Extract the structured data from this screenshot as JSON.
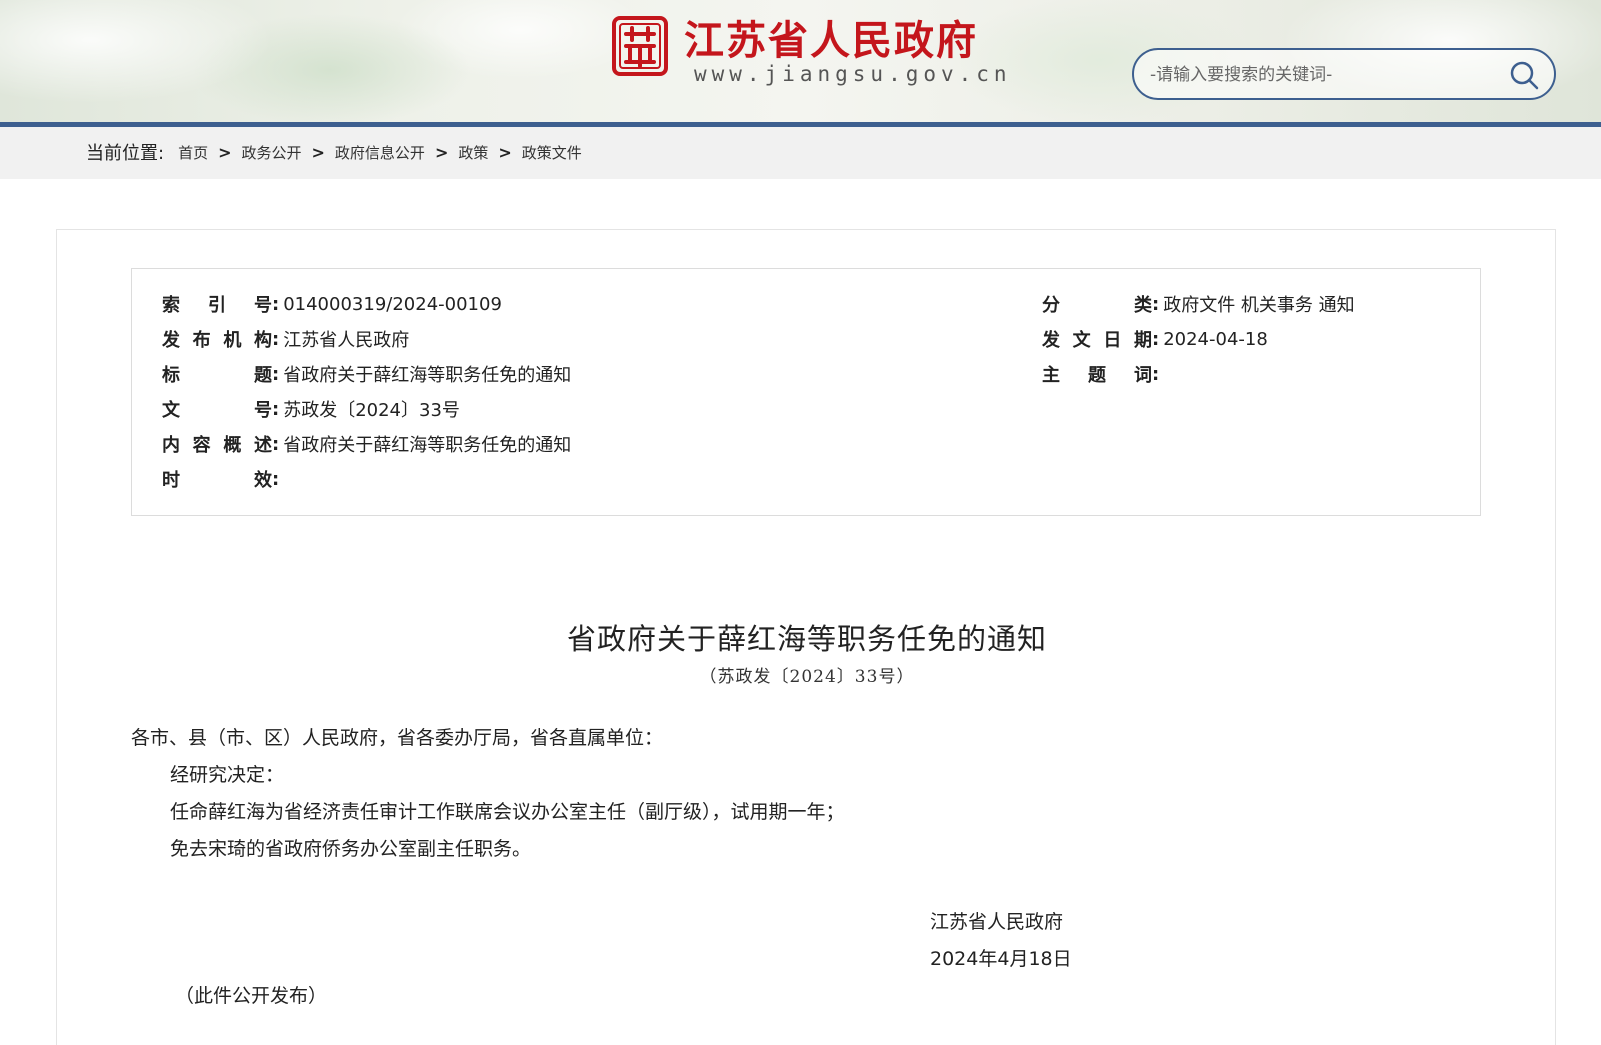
{
  "header": {
    "site_title": "江苏省人民政府",
    "site_url": "www.jiangsu.gov.cn",
    "search_placeholder": "-请输入要搜索的关键词-",
    "accent_color": "#3d5f8f",
    "brand_color": "#c4161c",
    "search_icon": "search-icon"
  },
  "breadcrumb": {
    "label": "当前位置:",
    "items": [
      "首页",
      "政务公开",
      "政府信息公开",
      "政策",
      "政策文件"
    ],
    "separator": ">"
  },
  "meta": {
    "index_no_label": "索引号",
    "index_no": "014000319/2024-00109",
    "category_label": "分类",
    "category": "政府文件 机关事务 通知",
    "publisher_label": "发布机构",
    "publisher": "江苏省人民政府",
    "issue_date_label": "发文日期",
    "issue_date": "2024-04-18",
    "title_label": "标题",
    "title": "省政府关于薛红海等职务任免的通知",
    "keywords_label": "主题词",
    "keywords": "",
    "doc_no_label": "文号",
    "doc_no": "苏政发〔2024〕33号",
    "summary_label": "内容概述",
    "summary": "省政府关于薛红海等职务任免的通知",
    "validity_label": "时效",
    "validity": ""
  },
  "document": {
    "title": "省政府关于薛红海等职务任免的通知",
    "number": "（苏政发〔2024〕33号）",
    "salutation": "各市、县（市、区）人民政府，省各委办厅局，省各直属单位：",
    "paragraphs": [
      "经研究决定：",
      "任命薛红海为省经济责任审计工作联席会议办公室主任（副厅级），试用期一年；",
      "免去宋琦的省政府侨务办公室副主任职务。"
    ],
    "signature_org": "江苏省人民政府",
    "signature_date": "2024年4月18日",
    "release_note": "（此件公开发布）"
  }
}
